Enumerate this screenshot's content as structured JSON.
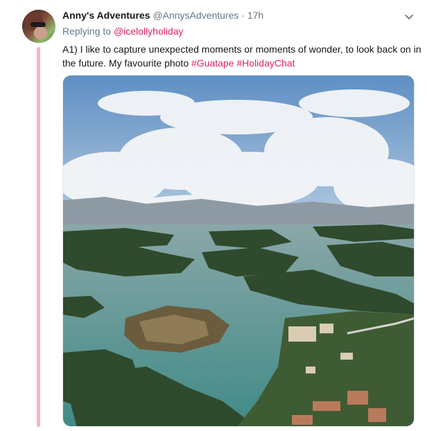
{
  "tweet": {
    "author_name": "Anny's Adventures",
    "author_handle": "@AnnysAdventures",
    "separator": "·",
    "time": "17h",
    "reply_prefix": "Replying to",
    "reply_to": "@icelollyholiday",
    "text": "A1) I like to capture unexpected moments or moments of wonder, to look back on in the future. My favourite photo ",
    "hashtags": [
      "#Guatape",
      "#HolidayChat"
    ],
    "caret_icon": "chevron-down-icon",
    "image": "aerial-lake-landscape"
  },
  "colors": {
    "link": "#e0245e",
    "muted": "#657786",
    "thread": "#f7b3c8"
  }
}
